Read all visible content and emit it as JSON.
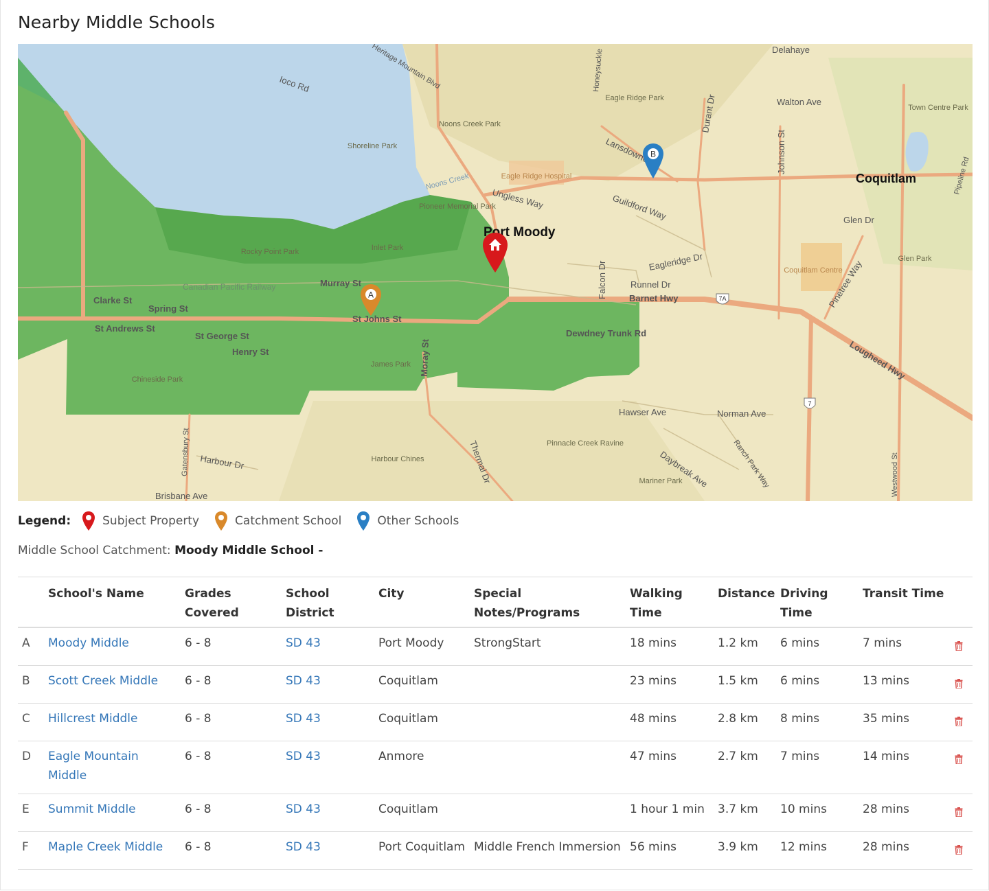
{
  "section_title": "Nearby Middle Schools",
  "map": {
    "place_labels": {
      "port_moody": "Port Moody",
      "coquitlam": "Coquitlam"
    },
    "street_labels": {
      "ioco_rd": "Ioco Rd",
      "heritage_mountain_blvd": "Heritage Mountain Blvd",
      "ungless_way": "Ungless Way",
      "guildford_way": "Guildford Way",
      "eagleridge_dr": "Eagleridge Dr",
      "runnel_dr": "Runnel Dr",
      "barnet_hwy": "Barnet Hwy",
      "murray_st": "Murray St",
      "clarke_st": "Clarke St",
      "spring_st": "Spring St",
      "st_johns_st": "St Johns St",
      "st_andrews_st": "St Andrews St",
      "st_george_st": "St George St",
      "henry_st": "Henry St",
      "dewdney_trunk_rd": "Dewdney Trunk Rd",
      "hawser_ave": "Hawser Ave",
      "norman_ave": "Norman Ave",
      "harbour_dr": "Harbour Dr",
      "brisbane_ave": "Brisbane Ave",
      "lougheed_hwy": "Lougheed Hwy",
      "walton_ave": "Walton Ave",
      "glen_dr": "Glen Dr",
      "pinetree_way": "Pinetree Way",
      "johnson_st": "Johnson St",
      "delahaye": "Delahaye",
      "lansdowne": "Lansdowne",
      "durant_dr": "Durant Dr",
      "moray_st": "Moray St",
      "falcon_dr": "Falcon Dr",
      "thermal_dr": "Thermal Dr",
      "westwood_st": "Westwood St",
      "gatensbury_st": "Gatensbury St",
      "daybreak_ave": "Daybreak Ave",
      "ranch_park_way": "Ranch Park Way",
      "pipeline_rd": "Pipeline Rd",
      "honeysuckle": "Honeysuckle",
      "noons_creek_stream": "Noons Creek",
      "canadian_pacific_railway": "Canadian Pacific Railway"
    },
    "park_labels": {
      "shoreline_park": "Shoreline Park",
      "noons_creek_park": "Noons Creek Park",
      "pioneer_memorial_park": "Pioneer Memorial Park",
      "rocky_point_park": "Rocky Point Park",
      "inlet_park": "Inlet Park",
      "james_park": "James Park",
      "chineside_park": "Chineside Park",
      "harbour_chines": "Harbour Chines",
      "pinnacle_creek_ravine": "Pinnacle Creek Ravine",
      "mariner_park": "Mariner Park",
      "eagle_ridge_park": "Eagle Ridge Park",
      "town_centre_park": "Town Centre Park",
      "glen_park": "Glen Park",
      "eagle_ridge_hospital": "Eagle Ridge Hospital",
      "coquitlam_centre": "Coquitlam Centre"
    },
    "highway_shields": [
      "7A",
      "7"
    ],
    "markers": [
      {
        "label": "A",
        "type": "catchment",
        "color": "#d9892b"
      },
      {
        "label": "B",
        "type": "other",
        "color": "#2a7fc4"
      },
      {
        "label": "",
        "type": "subject",
        "color": "#d7191c",
        "icon": "home-icon"
      }
    ],
    "colors": {
      "land": "#efe7c3",
      "water": "#bcd6ea",
      "catchment_fill": "#3aa43a",
      "road": "#eba97f"
    }
  },
  "legend": {
    "label": "Legend:",
    "items": [
      {
        "text": "Subject Property",
        "color": "#d7191c"
      },
      {
        "text": "Catchment School",
        "color": "#d9892b"
      },
      {
        "text": "Other Schools",
        "color": "#2a7fc4"
      }
    ]
  },
  "catchment": {
    "prefix": "Middle School Catchment:",
    "value": "Moody Middle School -"
  },
  "table": {
    "headers": {
      "name": "School's Name",
      "grades": "Grades Covered",
      "district": "School District",
      "city": "City",
      "notes": "Special Notes/Programs",
      "walking": "Walking Time",
      "distance": "Distance",
      "driving": "Driving Time",
      "transit": "Transit Time"
    },
    "rows": [
      {
        "letter": "A",
        "name": "Moody Middle",
        "grades": "6 - 8",
        "district": "SD 43",
        "city": "Port Moody",
        "notes": "StrongStart",
        "walking": "18 mins",
        "distance": "1.2 km",
        "driving": "6 mins",
        "transit": "7 mins"
      },
      {
        "letter": "B",
        "name": "Scott Creek Middle",
        "grades": "6 - 8",
        "district": "SD 43",
        "city": "Coquitlam",
        "notes": "",
        "walking": "23 mins",
        "distance": "1.5 km",
        "driving": "6 mins",
        "transit": "13 mins"
      },
      {
        "letter": "C",
        "name": "Hillcrest Middle",
        "grades": "6 - 8",
        "district": "SD 43",
        "city": "Coquitlam",
        "notes": "",
        "walking": "48 mins",
        "distance": "2.8 km",
        "driving": "8 mins",
        "transit": "35 mins"
      },
      {
        "letter": "D",
        "name": "Eagle Mountain Middle",
        "grades": "6 - 8",
        "district": "SD 43",
        "city": "Anmore",
        "notes": "",
        "walking": "47 mins",
        "distance": "2.7 km",
        "driving": "7 mins",
        "transit": "14 mins"
      },
      {
        "letter": "E",
        "name": "Summit Middle",
        "grades": "6 - 8",
        "district": "SD 43",
        "city": "Coquitlam",
        "notes": "",
        "walking": "1 hour 1 min",
        "distance": "3.7 km",
        "driving": "10 mins",
        "transit": "28 mins"
      },
      {
        "letter": "F",
        "name": "Maple Creek Middle",
        "grades": "6 - 8",
        "district": "SD 43",
        "city": "Port Coquitlam",
        "notes": "Middle French Immersion",
        "walking": "56 mins",
        "distance": "3.9 km",
        "driving": "12 mins",
        "transit": "28 mins"
      }
    ],
    "delete_icon": "trash-icon",
    "link_color": "#3577b8",
    "delete_color": "#d9534f"
  }
}
